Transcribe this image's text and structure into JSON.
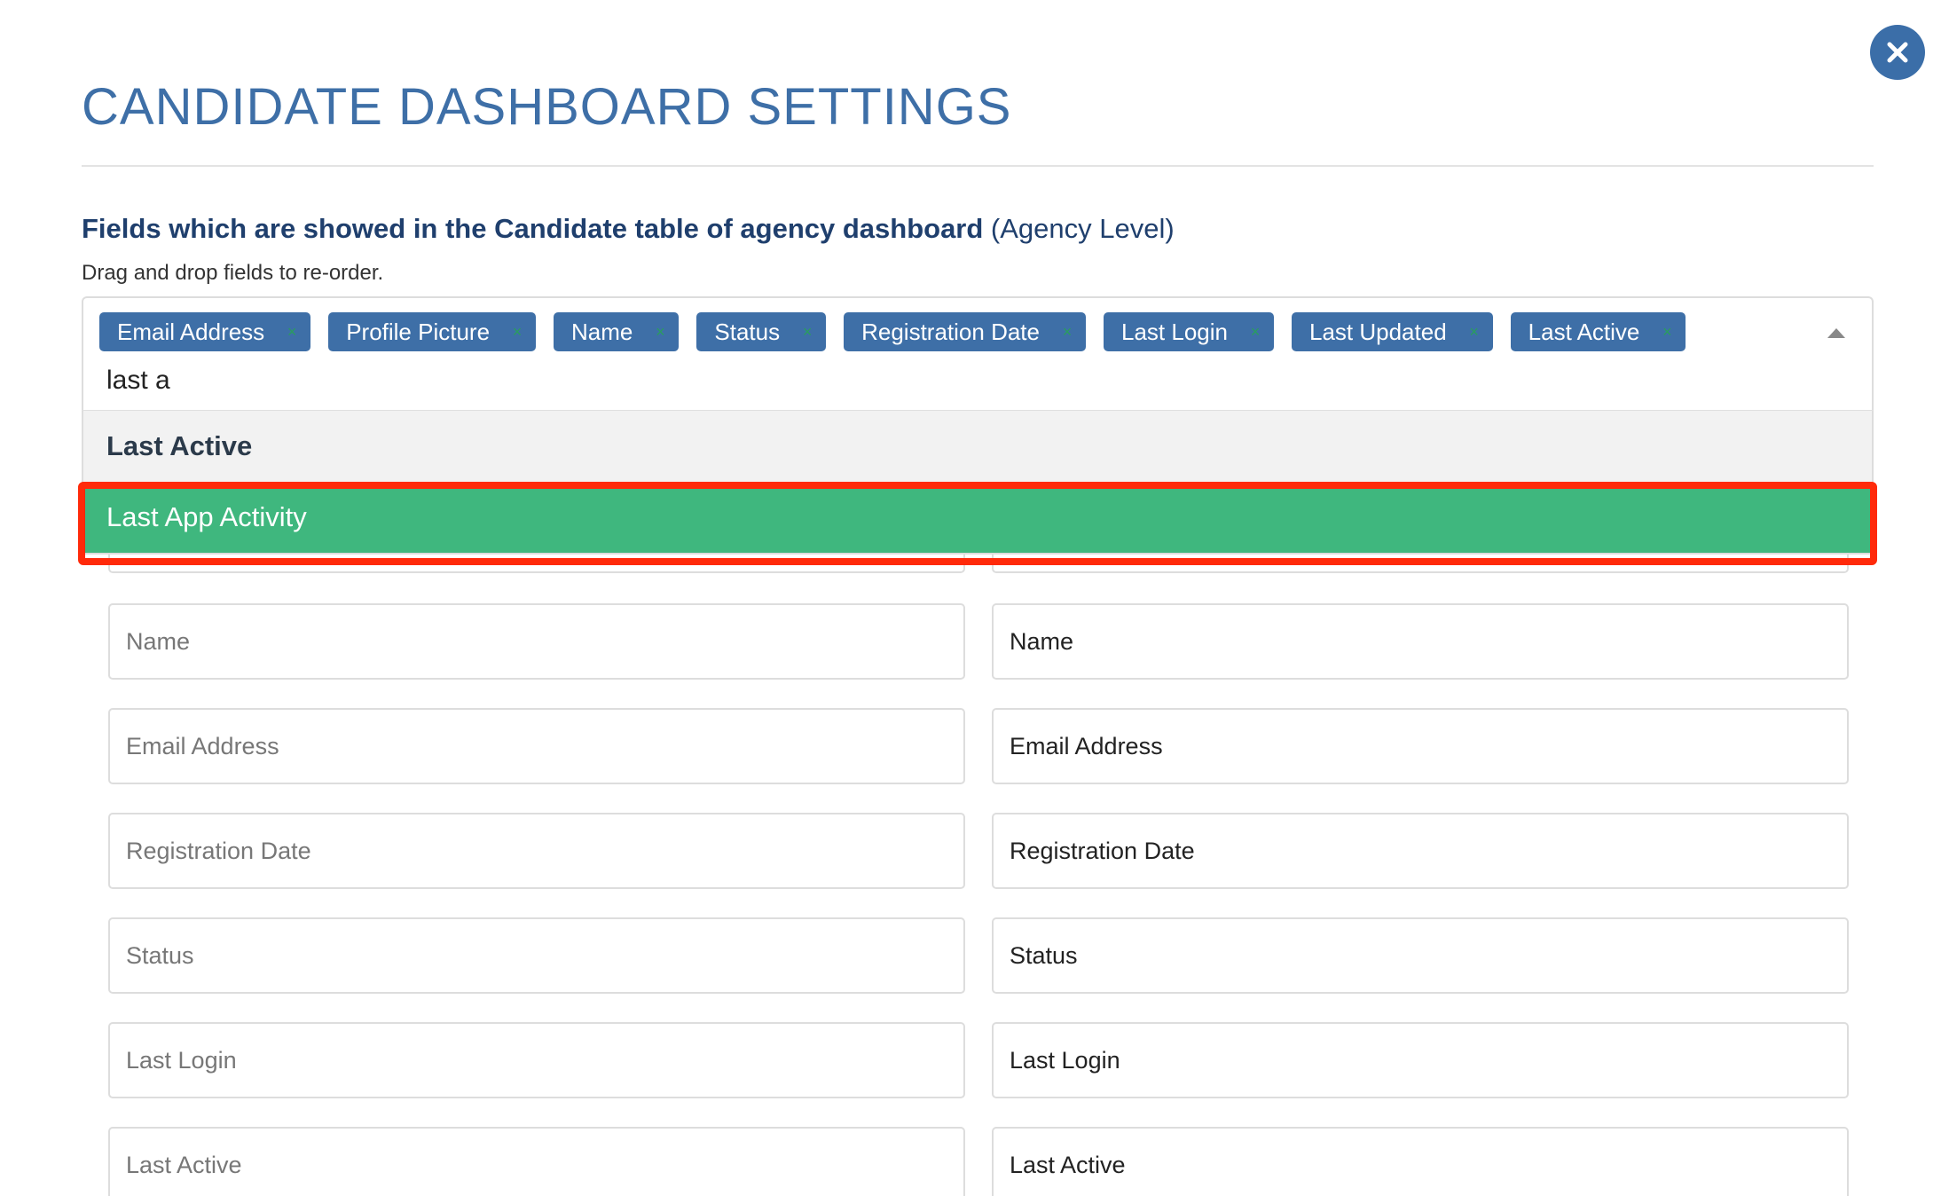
{
  "title": "CANDIDATE DASHBOARD SETTINGS",
  "section": {
    "heading_bold": "Fields which are showed in the Candidate table of agency dashboard",
    "heading_normal": " (Agency Level)",
    "helper": "Drag and drop fields to re-order."
  },
  "selected_fields": [
    {
      "label": "Email Address",
      "remove": "×"
    },
    {
      "label": "Profile Picture",
      "remove": "×"
    },
    {
      "label": "Name",
      "remove": "×"
    },
    {
      "label": "Status",
      "remove": "×"
    },
    {
      "label": "Registration Date",
      "remove": "×"
    },
    {
      "label": "Last Login",
      "remove": "×"
    },
    {
      "label": "Last Updated",
      "remove": "×"
    },
    {
      "label": "Last Active",
      "remove": "×"
    }
  ],
  "search": {
    "value": "last a"
  },
  "dropdown": {
    "options": [
      {
        "label": "Last Active",
        "state": "already-selected"
      },
      {
        "label": "Last App Activity",
        "state": "highlighted"
      }
    ]
  },
  "label_rows": [
    {
      "left_placeholder": "Name",
      "right_value": "Name"
    },
    {
      "left_placeholder": "Email Address",
      "right_value": "Email Address"
    },
    {
      "left_placeholder": "Registration Date",
      "right_value": "Registration Date"
    },
    {
      "left_placeholder": "Status",
      "right_value": "Status"
    },
    {
      "left_placeholder": "Last Login",
      "right_value": "Last Login"
    },
    {
      "left_placeholder": "Last Active",
      "right_value": "Last Active"
    }
  ],
  "colors": {
    "primary": "#3e6fa7",
    "highlight": "#3fb77e",
    "annotation_box": "#ff2a0a"
  },
  "icons": {
    "close": "close-icon",
    "caret": "caret-up-icon"
  }
}
